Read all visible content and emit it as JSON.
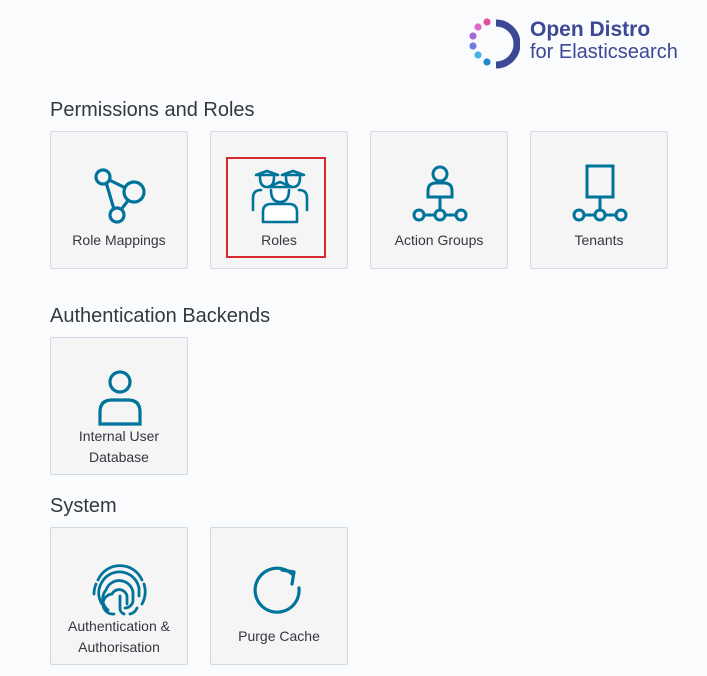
{
  "logo": {
    "line1": "Open Distro",
    "line2": "for Elasticsearch"
  },
  "sections": {
    "permissions": {
      "title": "Permissions and Roles",
      "tiles": {
        "role_mappings": "Role Mappings",
        "roles": "Roles",
        "action_groups": "Action Groups",
        "tenants": "Tenants"
      }
    },
    "authentication": {
      "title": "Authentication Backends",
      "tiles": {
        "internal_user_database_line1": "Internal User",
        "internal_user_database_line2": "Database"
      }
    },
    "system": {
      "title": "System",
      "tiles": {
        "auth_line1": "Authentication &",
        "auth_line2": "Authorisation",
        "purge_cache": "Purge Cache"
      }
    }
  },
  "colors": {
    "icon": "#00739a",
    "highlight": "#d6282e",
    "brand_text": "#3c4896"
  }
}
